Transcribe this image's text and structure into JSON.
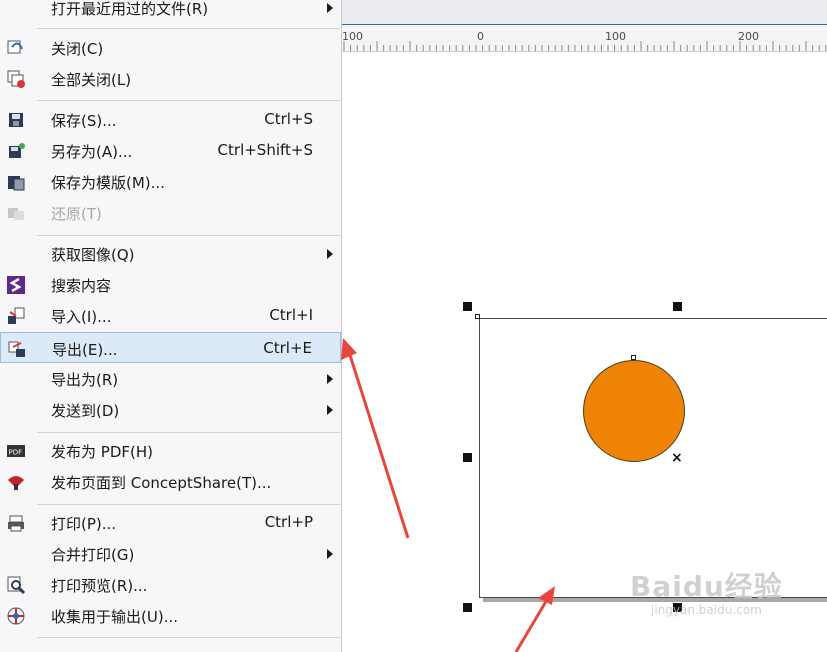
{
  "menu": {
    "items": [
      {
        "label": "打开最近用过的文件(R)",
        "shortcut": "",
        "submenu": true,
        "icon": "",
        "disabled": false,
        "highlight": false
      },
      {
        "label": "关闭(C)",
        "shortcut": "",
        "submenu": false,
        "icon": "close-document-icon",
        "disabled": false,
        "highlight": false
      },
      {
        "label": "全部关闭(L)",
        "shortcut": "",
        "submenu": false,
        "icon": "close-all-icon",
        "disabled": false,
        "highlight": false
      },
      {
        "label": "保存(S)...",
        "shortcut": "Ctrl+S",
        "submenu": false,
        "icon": "save-icon",
        "disabled": false,
        "highlight": false
      },
      {
        "label": "另存为(A)...",
        "shortcut": "Ctrl+Shift+S",
        "submenu": false,
        "icon": "save-as-icon",
        "disabled": false,
        "highlight": false
      },
      {
        "label": "保存为模版(M)...",
        "shortcut": "",
        "submenu": false,
        "icon": "save-template-icon",
        "disabled": false,
        "highlight": false
      },
      {
        "label": "还原(T)",
        "shortcut": "",
        "submenu": false,
        "icon": "revert-icon",
        "disabled": true,
        "highlight": false
      },
      {
        "label": "获取图像(Q)",
        "shortcut": "",
        "submenu": true,
        "icon": "",
        "disabled": false,
        "highlight": false
      },
      {
        "label": "搜索内容",
        "shortcut": "",
        "submenu": false,
        "icon": "search-content-icon",
        "disabled": false,
        "highlight": false
      },
      {
        "label": "导入(I)...",
        "shortcut": "Ctrl+I",
        "submenu": false,
        "icon": "import-icon",
        "disabled": false,
        "highlight": false
      },
      {
        "label": "导出(E)...",
        "shortcut": "Ctrl+E",
        "submenu": false,
        "icon": "export-icon",
        "disabled": false,
        "highlight": true
      },
      {
        "label": "导出为(R)",
        "shortcut": "",
        "submenu": true,
        "icon": "",
        "disabled": false,
        "highlight": false
      },
      {
        "label": "发送到(D)",
        "shortcut": "",
        "submenu": true,
        "icon": "",
        "disabled": false,
        "highlight": false
      },
      {
        "label": "发布为 PDF(H)",
        "shortcut": "",
        "submenu": false,
        "icon": "pdf-icon",
        "disabled": false,
        "highlight": false
      },
      {
        "label": "发布页面到 ConceptShare(T)...",
        "shortcut": "",
        "submenu": false,
        "icon": "conceptshare-icon",
        "disabled": false,
        "highlight": false
      },
      {
        "label": "打印(P)...",
        "shortcut": "Ctrl+P",
        "submenu": false,
        "icon": "print-icon",
        "disabled": false,
        "highlight": false
      },
      {
        "label": "合并打印(G)",
        "shortcut": "",
        "submenu": true,
        "icon": "",
        "disabled": false,
        "highlight": false
      },
      {
        "label": "打印预览(R)...",
        "shortcut": "",
        "submenu": false,
        "icon": "print-preview-icon",
        "disabled": false,
        "highlight": false
      },
      {
        "label": "收集用于输出(U)...",
        "shortcut": "",
        "submenu": false,
        "icon": "collect-for-output-icon",
        "disabled": false,
        "highlight": false
      }
    ]
  },
  "ruler": {
    "labels": [
      "100",
      "0",
      "100",
      "200"
    ]
  },
  "watermark": {
    "main": "Baidu经验",
    "sub": "jingyan.baidu.com"
  },
  "colors": {
    "circle_fill": "#ef8306",
    "highlight": "#dce9f7",
    "arrow": "#e8453c"
  }
}
